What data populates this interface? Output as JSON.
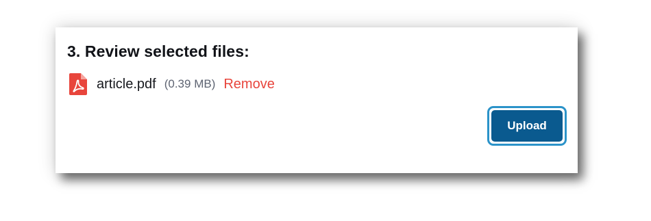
{
  "review": {
    "heading": "3. Review selected files:",
    "files": [
      {
        "icon": "pdf-file-icon",
        "name": "article.pdf",
        "size": "(0.39 MB)",
        "remove_label": "Remove"
      }
    ]
  },
  "actions": {
    "upload_label": "Upload"
  },
  "colors": {
    "pdf_icon": "#e8453c",
    "remove_link": "#e8453c",
    "upload_button": "#0a5a8f",
    "upload_focus_ring": "#2b93c9"
  }
}
